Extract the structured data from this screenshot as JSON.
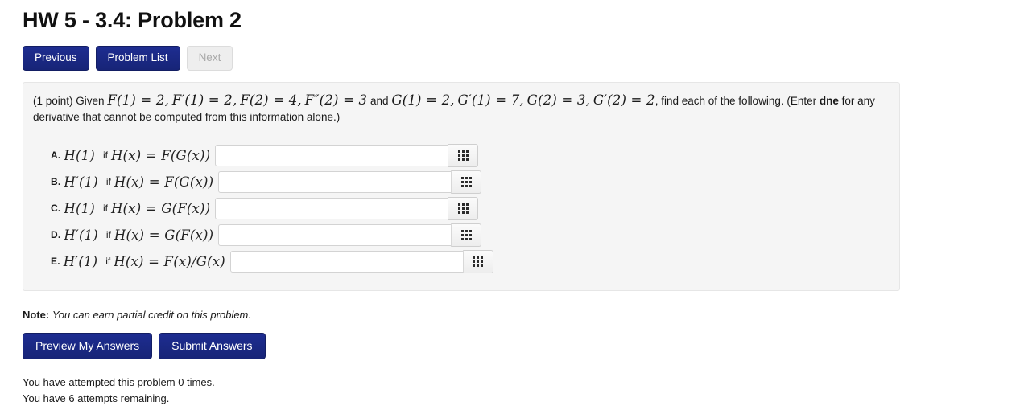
{
  "header": {
    "title": "HW 5 - 3.4: Problem 2"
  },
  "nav": {
    "previous_label": "Previous",
    "problem_list_label": "Problem List",
    "next_label": "Next"
  },
  "problem": {
    "points": "(1 point)",
    "given_word": "Given",
    "given_math": "F(1) = 2, F′(1) = 2, F(2) = 4, F″(2) = 3",
    "and_word": "and",
    "given_math2": "G(1) = 2, G′(1) = 7, G(2) = 3, G′(2) = 2",
    "instruction_a": ", find each of the following. (Enter ",
    "instruction_bold": "dne",
    "instruction_b": " for any derivative that cannot be computed from this information alone.)",
    "math_parts": {
      "F1": "F(1) = 2,",
      "Fp1": "F′(1) = 2,",
      "F2": "F(2) = 4,",
      "Fpp2": "F″(2) = 3",
      "G1": "G(1) = 2,",
      "Gp1": "G′(1) = 7,",
      "G2": "G(2) = 3,",
      "Gp2": "G′(2) = 2"
    }
  },
  "answers": [
    {
      "label": "A.",
      "expr_left": "H(1)",
      "if_word": "if",
      "expr_right": "H(x) = F(G(x))",
      "value": "",
      "field_width": 290,
      "indent": 0,
      "keypad_icon": "keypad-grid-icon"
    },
    {
      "label": "B.",
      "expr_left": "H′(1)",
      "if_word": "if",
      "expr_right": "H(x) = F(G(x))",
      "value": "",
      "field_width": 290,
      "indent": 0,
      "keypad_icon": "keypad-grid-icon"
    },
    {
      "label": "C.",
      "expr_left": "H(1)",
      "if_word": "if",
      "expr_right": "H(x) = G(F(x))",
      "value": "",
      "field_width": 290,
      "indent": 0,
      "keypad_icon": "keypad-grid-icon"
    },
    {
      "label": "D.",
      "expr_left": "H′(1)",
      "if_word": "if",
      "expr_right": "H(x) = G(F(x))",
      "value": "",
      "field_width": 290,
      "indent": 0,
      "keypad_icon": "keypad-grid-icon"
    },
    {
      "label": "E.",
      "expr_left": "H′(1)",
      "if_word": "if",
      "expr_right": "H(x) = F(x)/G(x)",
      "value": "",
      "field_width": 290,
      "indent": 0,
      "keypad_icon": "keypad-grid-icon"
    }
  ],
  "note": {
    "label": "Note:",
    "text": "You can earn partial credit on this problem."
  },
  "actions": {
    "preview_label": "Preview My Answers",
    "submit_label": "Submit Answers"
  },
  "attempts": {
    "line1": "You have attempted this problem 0 times.",
    "line2": "You have 6 attempts remaining."
  },
  "colors": {
    "primary_button": "#1e2d91",
    "panel_background": "#f5f5f5",
    "page_background": "#ffffff"
  }
}
